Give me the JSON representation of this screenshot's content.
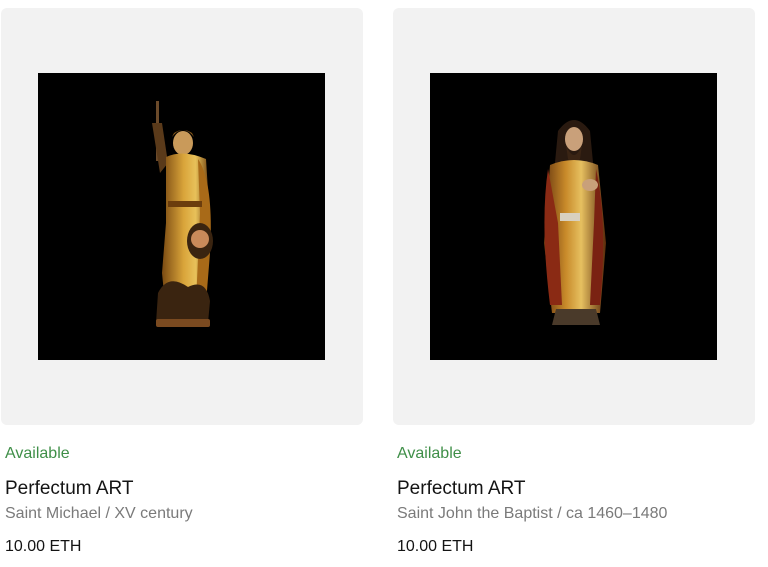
{
  "cards": [
    {
      "status": "Available",
      "creator": "Perfectum ART",
      "artwork_title": "Saint Michael / XV century",
      "price": "10.00 ETH",
      "image_subject": "gilded wooden sculpture of Saint Michael with spear and shield"
    },
    {
      "status": "Available",
      "creator": "Perfectum ART",
      "artwork_title": "Saint John the Baptist / ca 1460–1480",
      "price": "10.00 ETH",
      "image_subject": "gilded wooden sculpture of Saint John the Baptist"
    }
  ],
  "colors": {
    "status_available": "#3f8f48",
    "card_background": "#f2f2f2",
    "artwork_background": "#000000"
  }
}
